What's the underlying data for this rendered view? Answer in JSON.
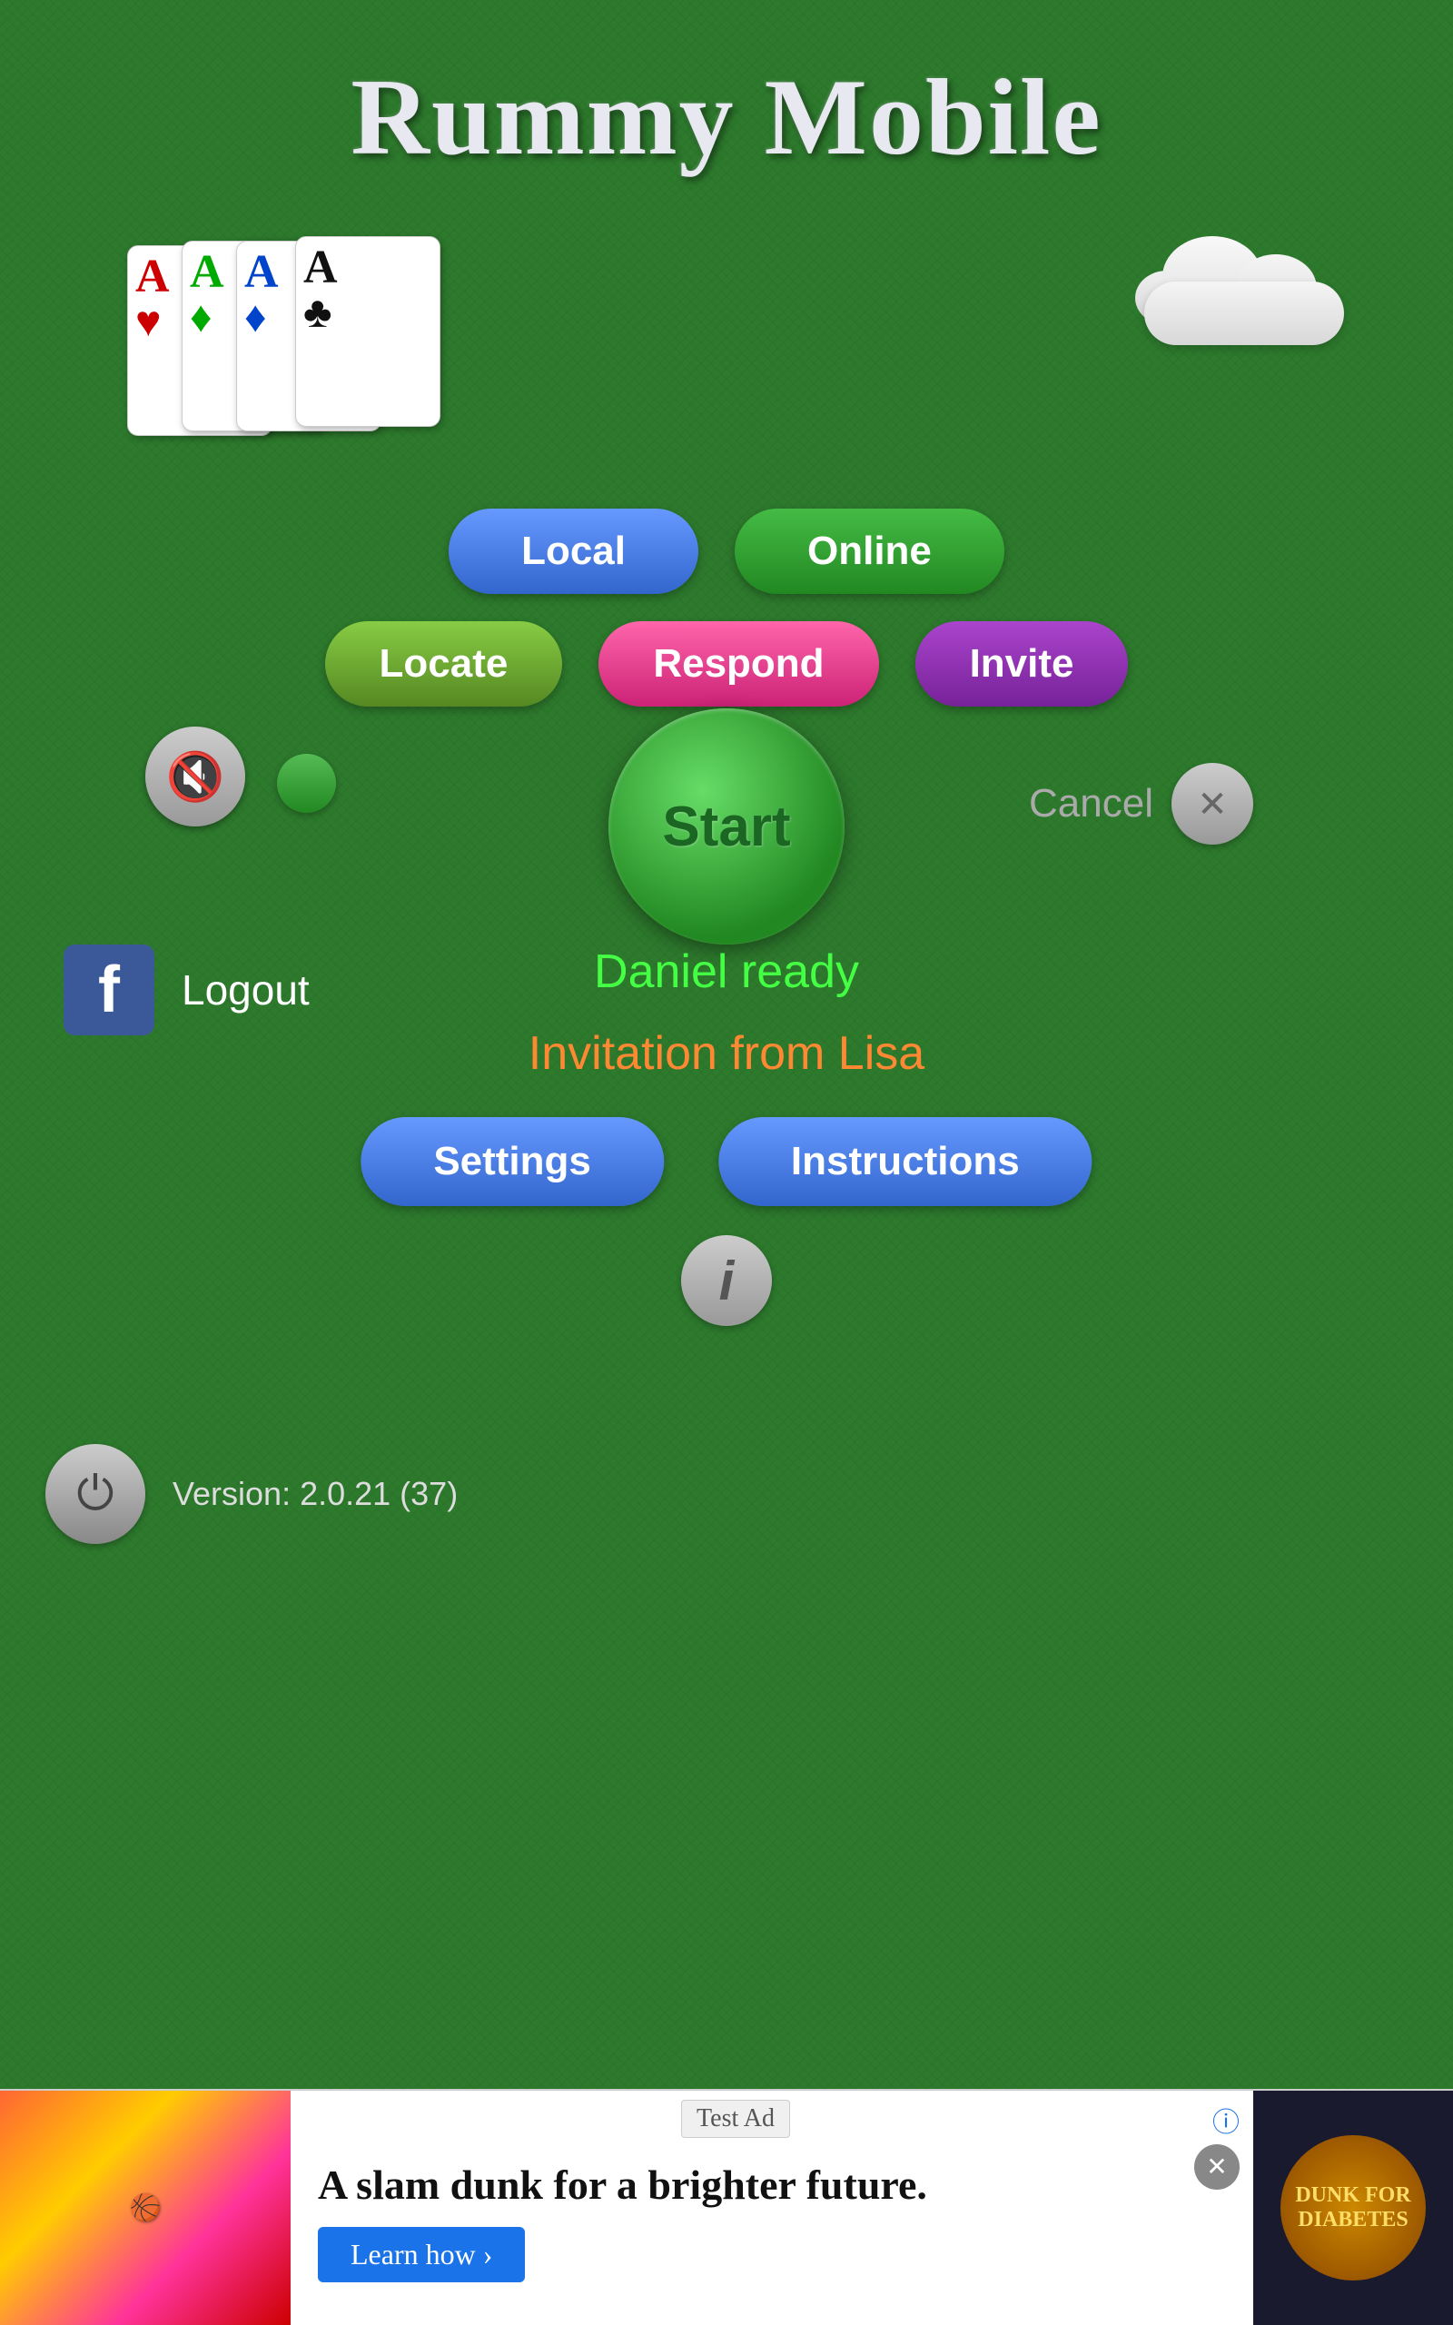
{
  "title": "Rummy Mobile",
  "cards": [
    {
      "letter": "A",
      "suit": "♥",
      "color": "#cc0000"
    },
    {
      "letter": "A",
      "suit": "♦",
      "color": "#00aa00"
    },
    {
      "letter": "A",
      "suit": "♦",
      "color": "#0044cc"
    },
    {
      "letter": "A",
      "suit": "♣",
      "color": "#111111"
    }
  ],
  "buttons": {
    "local": "Local",
    "online": "Online",
    "locate": "Locate",
    "respond": "Respond",
    "invite": "Invite",
    "start": "Start",
    "cancel": "Cancel",
    "logout": "Logout",
    "settings": "Settings",
    "instructions": "Instructions"
  },
  "status": {
    "daniel_ready": "Daniel ready",
    "invitation": "Invitation from Lisa"
  },
  "version": "Version: 2.0.21 (37)",
  "ad": {
    "test_label": "Test Ad",
    "title": "A slam dunk for a brighter future.",
    "cta": "Learn how ›",
    "logo_text": "DUNK FOR DIABETES"
  },
  "icons": {
    "mute": "🔇",
    "power": "⏻",
    "info": "i",
    "facebook": "f",
    "cancel_x": "✕",
    "ad_info": "ⓘ",
    "ad_close": "✕"
  }
}
